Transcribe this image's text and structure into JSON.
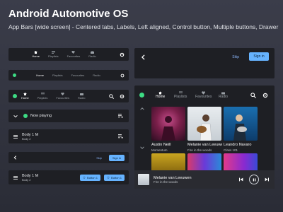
{
  "header": {
    "title": "Android Automotive OS",
    "subtitle": "App Bars [wide screen] - Centered tabs, Labels, Left aligned, Control button, Multiple buttons, Drawer"
  },
  "tabs": {
    "home": "Home",
    "playlists": "Playlists",
    "favourites": "Favourites",
    "radio": "Radio"
  },
  "now_playing": "Now playing",
  "body_label": {
    "title": "Body 1 M",
    "sub": "Body 2"
  },
  "actions": {
    "skip": "Skip",
    "sign_in": "Sign in",
    "button1": "Button 1"
  },
  "media": {
    "cards": [
      {
        "title": "Austin Neill",
        "sub": "Momentum"
      },
      {
        "title": "Melanie van Leeuwen",
        "sub": "Fire in the woods"
      },
      {
        "title": "Leandro Navaro",
        "sub": "Class 101"
      }
    ],
    "player": {
      "title": "Melanie van Leeuwen",
      "sub": "Fire in the woods"
    }
  },
  "colors": {
    "accent": "#3ddc84",
    "primary_button": "#66b3ff",
    "bar_bg": "#1e1f24",
    "link": "#8ab4f8"
  }
}
